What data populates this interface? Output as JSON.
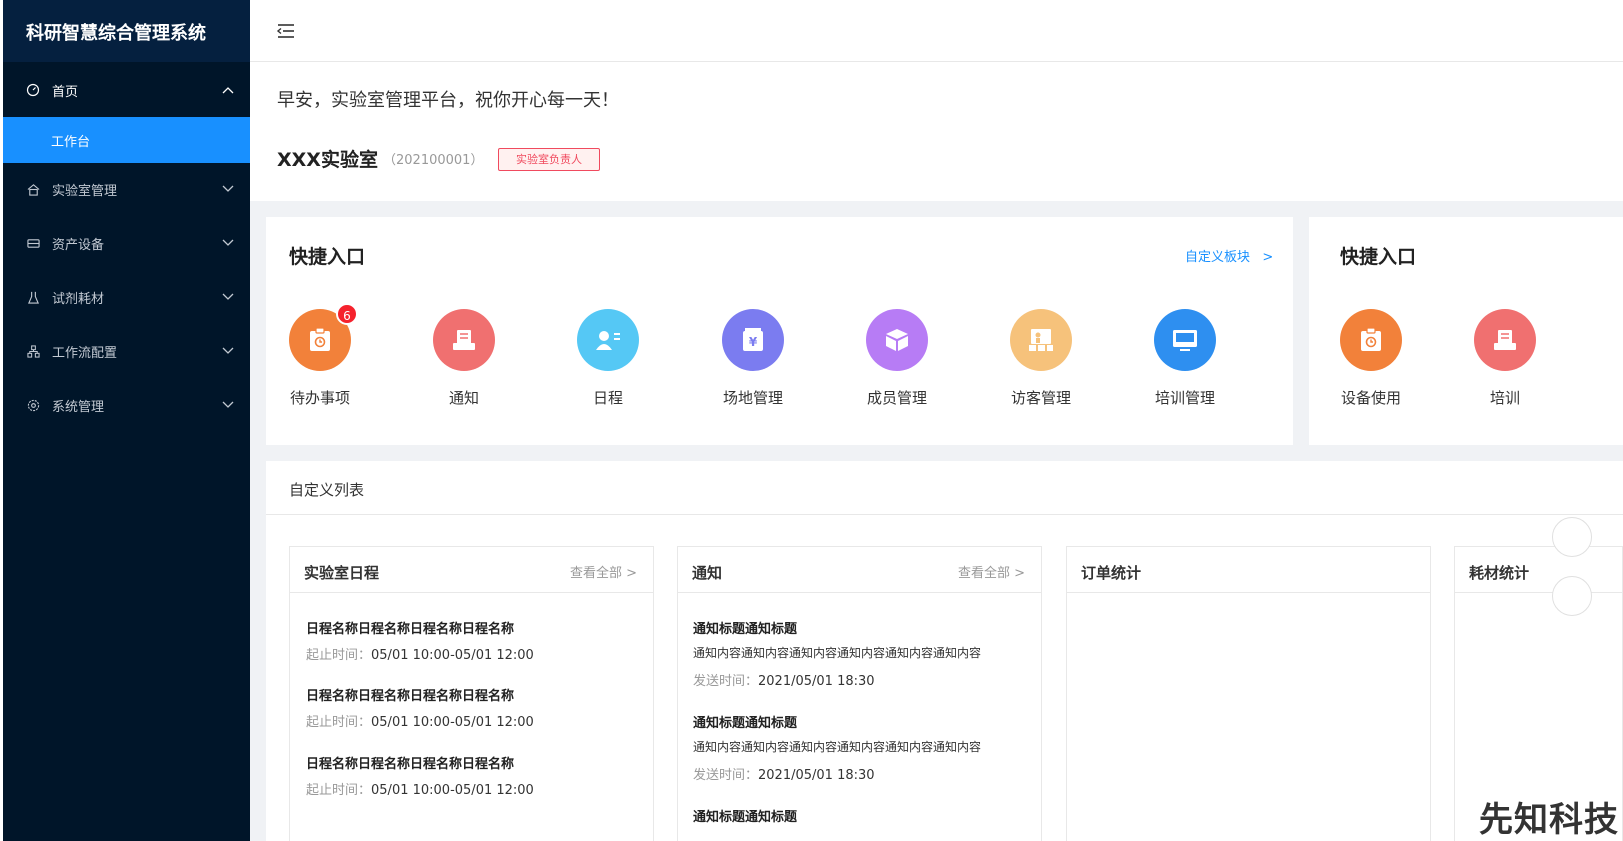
{
  "app": {
    "title": "科研智慧综合管理系统"
  },
  "sidebar": {
    "items": [
      {
        "label": "首页",
        "icon": "dashboard-icon",
        "expanded": true
      },
      {
        "label": "实验室管理",
        "icon": "home-icon"
      },
      {
        "label": "资产设备",
        "icon": "device-icon"
      },
      {
        "label": "试剂耗材",
        "icon": "flask-icon"
      },
      {
        "label": "工作流配置",
        "icon": "workflow-icon"
      },
      {
        "label": "系统管理",
        "icon": "gear-icon"
      }
    ],
    "submenu": {
      "label": "工作台"
    }
  },
  "header": {
    "greeting": "早安，实验室管理平台，祝你开心每一天！",
    "lab_name": "XXX实验室",
    "lab_code": "（202100001）",
    "role": "实验室负责人"
  },
  "quick_entry": {
    "title": "快捷入口",
    "customize": "自定义板块",
    "customize_arrow": ">",
    "items": [
      {
        "label": "待办事项",
        "icon": "clipboard-icon",
        "color": "#f2813a",
        "badge": "6"
      },
      {
        "label": "通知",
        "icon": "notice-icon",
        "color": "#f07070"
      },
      {
        "label": "日程",
        "icon": "user-card-icon",
        "color": "#55c8f5"
      },
      {
        "label": "场地管理",
        "icon": "yen-icon",
        "color": "#7b7cf0"
      },
      {
        "label": "成员管理",
        "icon": "cube-icon",
        "color": "#b77cf5"
      },
      {
        "label": "访客管理",
        "icon": "visitor-icon",
        "color": "#f6c27b"
      },
      {
        "label": "培训管理",
        "icon": "monitor-icon",
        "color": "#2e8ff0"
      }
    ]
  },
  "quick_entry_2": {
    "title": "快捷入口",
    "items": [
      {
        "label": "设备使用",
        "icon": "clipboard-icon",
        "color": "#f2813a"
      },
      {
        "label": "培训",
        "icon": "notice-icon",
        "color": "#f07070"
      }
    ]
  },
  "custom_list": {
    "title": "自定义列表",
    "panels": {
      "schedule": {
        "title": "实验室日程",
        "more": "查看全部 >",
        "items": [
          {
            "title": "日程名称日程名称日程名称日程名称",
            "meta_label": "起止时间：",
            "meta_value": "05/01 10:00-05/01 12:00"
          },
          {
            "title": "日程名称日程名称日程名称日程名称",
            "meta_label": "起止时间：",
            "meta_value": "05/01 10:00-05/01 12:00"
          },
          {
            "title": "日程名称日程名称日程名称日程名称",
            "meta_label": "起止时间：",
            "meta_value": "05/01 10:00-05/01 12:00"
          }
        ]
      },
      "notice": {
        "title": "通知",
        "more": "查看全部 >",
        "items": [
          {
            "title": "通知标题通知标题",
            "content": "通知内容通知内容通知内容通知内容通知内容通知内容",
            "meta_label": "发送时间：",
            "meta_value": "2021/05/01 18:30"
          },
          {
            "title": "通知标题通知标题",
            "content": "通知内容通知内容通知内容通知内容通知内容通知内容",
            "meta_label": "发送时间：",
            "meta_value": "2021/05/01 18:30"
          },
          {
            "title": "通知标题通知标题"
          }
        ]
      },
      "orders": {
        "title": "订单统计"
      },
      "consumables": {
        "title": "耗材统计"
      }
    }
  },
  "watermark": "先知科技"
}
